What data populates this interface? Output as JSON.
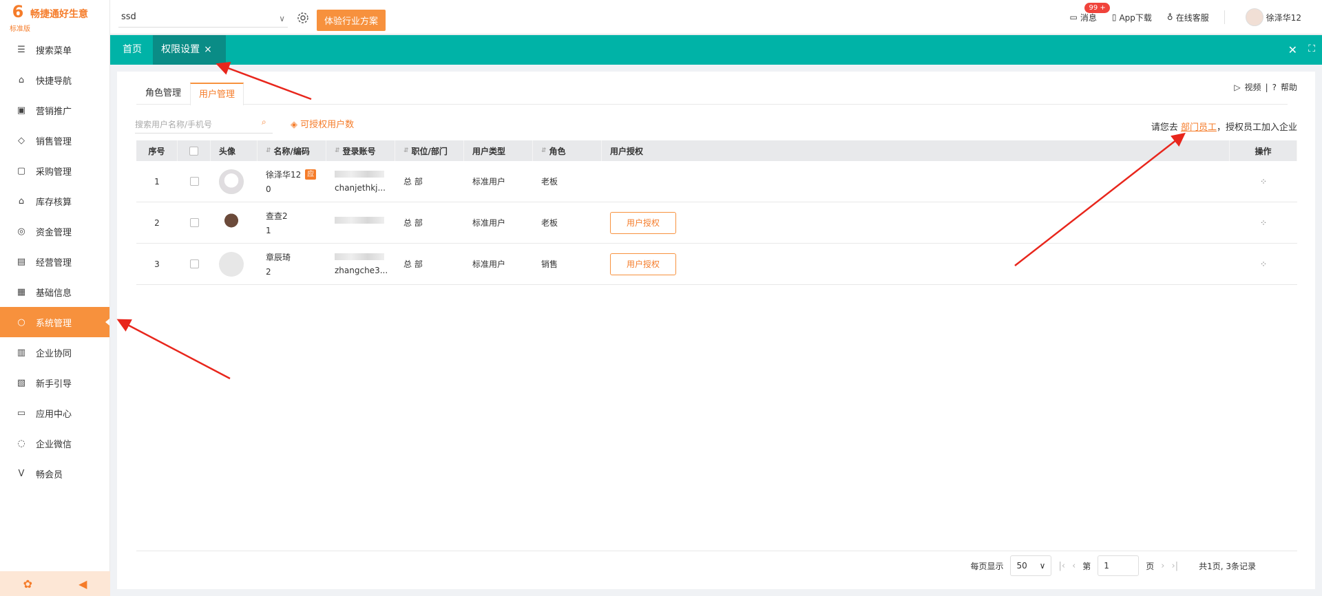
{
  "brand": {
    "name": "畅捷通好生意",
    "edition": "标准版",
    "logo_char": "6"
  },
  "sidebar": {
    "items": [
      {
        "label": "搜索菜单",
        "icon": "search-menu-icon",
        "glyph": "☰"
      },
      {
        "label": "快捷导航",
        "icon": "home-icon",
        "glyph": "⌂"
      },
      {
        "label": "营销推广",
        "icon": "gift-icon",
        "glyph": "▣"
      },
      {
        "label": "销售管理",
        "icon": "sales-icon",
        "glyph": "◇"
      },
      {
        "label": "采购管理",
        "icon": "bag-icon",
        "glyph": "▢"
      },
      {
        "label": "库存核算",
        "icon": "warehouse-icon",
        "glyph": "⌂"
      },
      {
        "label": "资金管理",
        "icon": "money-bag-icon",
        "glyph": "◎"
      },
      {
        "label": "经营管理",
        "icon": "clipboard-icon",
        "glyph": "▤"
      },
      {
        "label": "基础信息",
        "icon": "id-card-icon",
        "glyph": "▦"
      },
      {
        "label": "系统管理",
        "icon": "system-icon",
        "glyph": "○"
      },
      {
        "label": "企业协同",
        "icon": "collab-icon",
        "glyph": "▥"
      },
      {
        "label": "新手引导",
        "icon": "guide-icon",
        "glyph": "▧"
      },
      {
        "label": "应用中心",
        "icon": "app-center-icon",
        "glyph": "▭"
      },
      {
        "label": "企业微信",
        "icon": "wechat-icon",
        "glyph": "◌"
      },
      {
        "label": "畅会员",
        "icon": "vip-icon",
        "glyph": "V"
      }
    ],
    "active_index": 9,
    "footer": {
      "settings_glyph": "✿",
      "collapse_glyph": "◀"
    }
  },
  "header": {
    "company": "ssd",
    "trial_button": "体验行业方案",
    "messages_label": "消息",
    "messages_badge": "99 +",
    "app_download": "App下载",
    "support": "在线客服",
    "user_name": "徐泽华12"
  },
  "tabs": {
    "home": "首页",
    "current": "权限设置",
    "close_glyph": "×",
    "close_all_glyph": "✕",
    "fullscreen_glyph": "⛶"
  },
  "subtabs": {
    "role": "角色管理",
    "user": "用户管理"
  },
  "help": {
    "video": "视频",
    "help": "帮助",
    "sep": "|"
  },
  "toolbar": {
    "search_placeholder": "搜索用户名称/手机号",
    "quota_label": "可授权用户数",
    "invite_prefix": "请您去",
    "invite_link": "部门员工",
    "invite_suffix": "，授权员工加入企业"
  },
  "table": {
    "headers": [
      "序号",
      "头像",
      "名称/编码",
      "登录账号",
      "职位/部门",
      "用户类型",
      "角色",
      "用户授权",
      "操作"
    ],
    "rows": [
      {
        "no": "1",
        "name": "徐泽华12",
        "tag": "应",
        "code": "0",
        "account": "chanjethkj...",
        "dept": "总 部",
        "type": "标准用户",
        "role": "老板",
        "auth": ""
      },
      {
        "no": "2",
        "name": "查查2",
        "tag": "",
        "code": "1",
        "account": "",
        "dept": "总 部",
        "type": "标准用户",
        "role": "老板",
        "auth": "用户授权"
      },
      {
        "no": "3",
        "name": "章辰琦",
        "tag": "",
        "code": "2",
        "account": "zhangche3...",
        "dept": "总 部",
        "type": "标准用户",
        "role": "销售",
        "auth": "用户授权"
      }
    ]
  },
  "pagination": {
    "per_page_label": "每页显示",
    "per_page": "50",
    "page_prefix": "第",
    "page": "1",
    "page_suffix": "页",
    "summary": "共1页, 3条记录"
  },
  "colors": {
    "accent": "#f7913d",
    "teal": "#00b3a7",
    "annotation": "#e8261c"
  }
}
